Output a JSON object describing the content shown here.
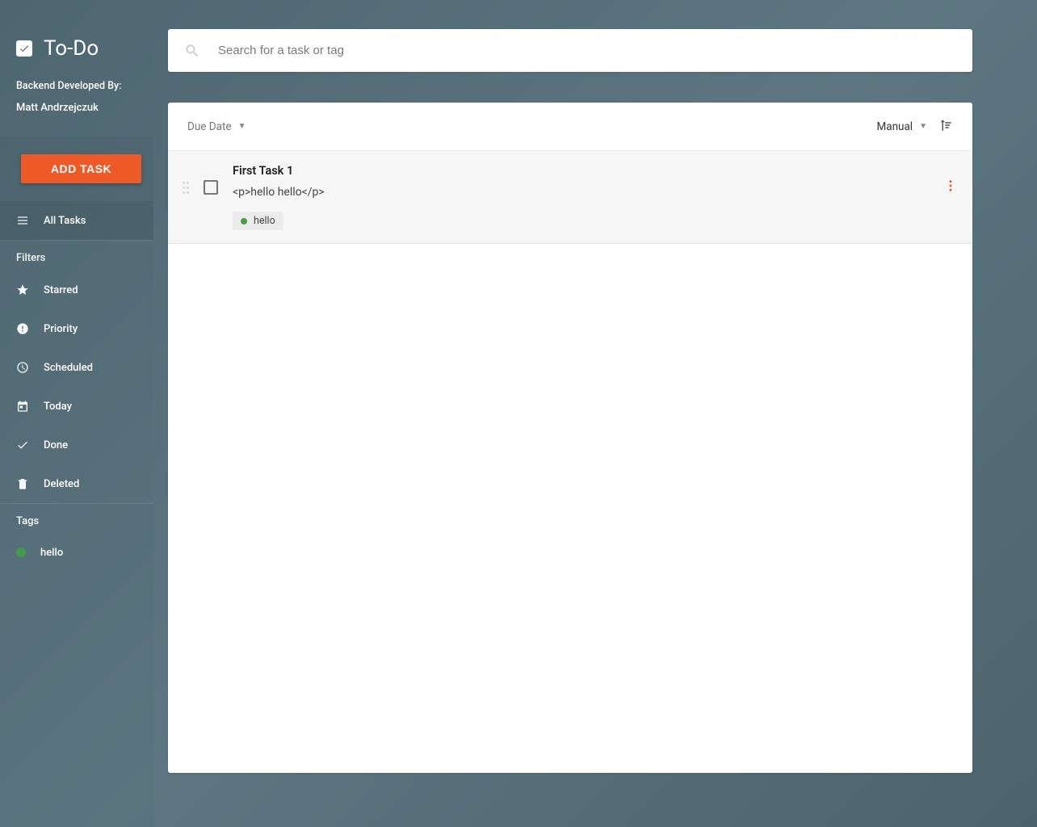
{
  "brand": {
    "title": "To-Do"
  },
  "credits": {
    "label": "Backend Developed By:",
    "author": "Matt Andrzejczuk"
  },
  "buttons": {
    "add_task": "ADD TASK"
  },
  "nav": {
    "all_tasks": "All Tasks",
    "filters_header": "Filters",
    "starred": "Starred",
    "priority": "Priority",
    "scheduled": "Scheduled",
    "today": "Today",
    "done": "Done",
    "deleted": "Deleted",
    "tags_header": "Tags"
  },
  "tags": [
    {
      "label": "hello",
      "color": "#40a241"
    }
  ],
  "search": {
    "placeholder": "Search for a task or tag"
  },
  "toolbar": {
    "group_by": "Due Date",
    "sort_by": "Manual"
  },
  "tasks": [
    {
      "title": "First Task 1",
      "description": "<p>hello hello</p>",
      "tags": [
        {
          "label": "hello",
          "color": "#40a241"
        }
      ]
    }
  ]
}
